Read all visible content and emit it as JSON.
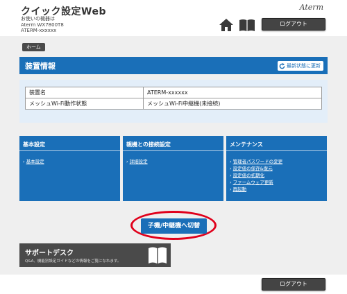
{
  "header": {
    "app_title": "クイック設定Web",
    "device_line1": "お使いの機器は",
    "device_line2": "Aterm WX7800T8",
    "device_line3": "ATERM-xxxxxx",
    "brand": "Aterm",
    "logout_label": "ログアウト"
  },
  "breadcrumb": {
    "home_label": "ホーム"
  },
  "device_info": {
    "title": "装置情報",
    "refresh_label": "最新状態に更新",
    "rows": [
      {
        "label": "装置名",
        "value": "ATERM-xxxxxx"
      },
      {
        "label": "メッシュWi-Fi動作状態",
        "value": "メッシュWi-Fi中継機(未接続)"
      }
    ]
  },
  "categories": {
    "basic": {
      "title": "基本設定",
      "links": [
        "基本設定"
      ]
    },
    "connection": {
      "title": "親機との接続設定",
      "links": [
        "詳細設定"
      ]
    },
    "maintenance": {
      "title": "メンテナンス",
      "links": [
        "管理者パスワードの変更",
        "設定値の保存&復元",
        "設定値の初期化",
        "ファームウェア更新",
        "再起動"
      ]
    }
  },
  "switch_button": {
    "label": "子機/中継機へ切替"
  },
  "support": {
    "title": "サポートデスク",
    "description": "Q&A、機能別設定ガイドなどの情報をご覧になれます。"
  },
  "footer": {
    "logout_label": "ログアウト"
  },
  "colors": {
    "accent": "#1a6fb8",
    "highlight_ring": "#e0001b",
    "dark_button": "#444444"
  }
}
